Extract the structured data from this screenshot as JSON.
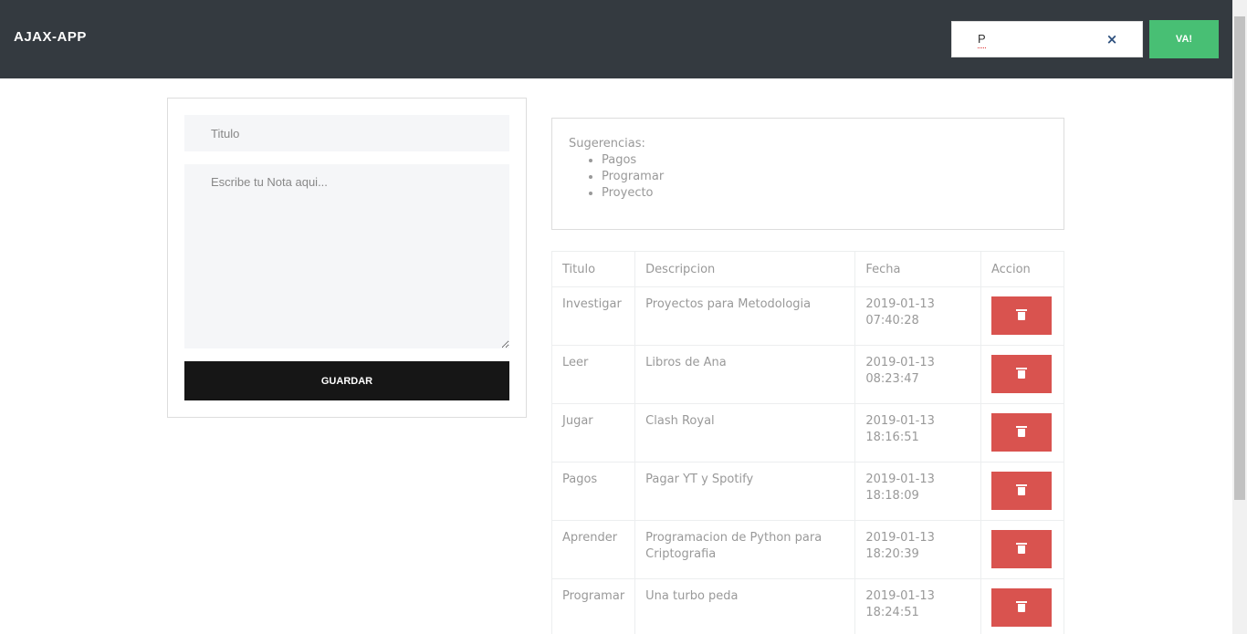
{
  "navbar": {
    "brand": "AJAX-APP",
    "search": {
      "value": "P",
      "clear_icon": "×"
    },
    "submit_label": "VA!"
  },
  "form": {
    "title_placeholder": "Titulo",
    "description_placeholder": "Escribe tu Nota aqui...",
    "save_label": "GUARDAR"
  },
  "suggestions": {
    "heading": "Sugerencias:",
    "items": [
      "Pagos",
      "Programar",
      "Proyecto"
    ]
  },
  "table": {
    "headers": [
      "Titulo",
      "Descripcion",
      "Fecha",
      "Accion"
    ],
    "rows": [
      {
        "titulo": "Investigar",
        "descripcion": "Proyectos para Metodologia",
        "fecha": "2019-01-13 07:40:28"
      },
      {
        "titulo": "Leer",
        "descripcion": "Libros de Ana",
        "fecha": "2019-01-13 08:23:47"
      },
      {
        "titulo": "Jugar",
        "descripcion": "Clash Royal",
        "fecha": "2019-01-13 18:16:51"
      },
      {
        "titulo": "Pagos",
        "descripcion": "Pagar YT y Spotify",
        "fecha": "2019-01-13 18:18:09"
      },
      {
        "titulo": "Aprender",
        "descripcion": "Programacion de Python para Criptografia",
        "fecha": "2019-01-13 18:20:39"
      },
      {
        "titulo": "Programar",
        "descripcion": "Una turbo peda",
        "fecha": "2019-01-13 18:24:51"
      }
    ],
    "delete_icon": "trash-icon"
  },
  "colors": {
    "navbar": "#343a40",
    "search_button": "#48bf74",
    "save_button": "#161616",
    "delete_button": "#d9534f",
    "clear_icon": "#2b4e7c"
  }
}
